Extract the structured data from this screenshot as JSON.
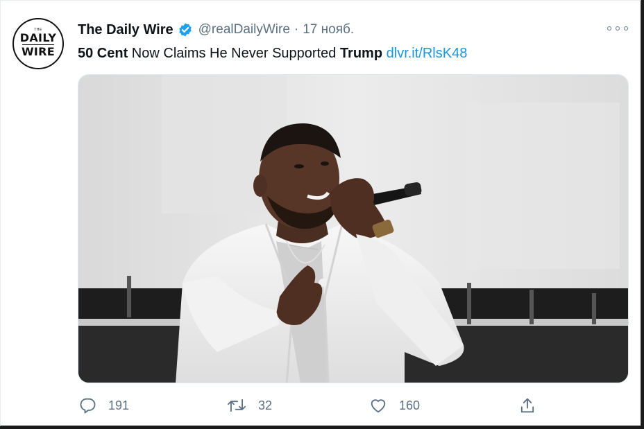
{
  "author": {
    "name": "The Daily Wire",
    "handle": "@realDailyWire",
    "separator": "·",
    "date": "17 нояб.",
    "avatar": {
      "top_text": "THE",
      "line1": "DAILY",
      "line2": "WIRE"
    }
  },
  "tweet": {
    "part1_bold": "50 Cent",
    "part2": " Now Claims He Never Supported ",
    "part3_bold": "Trump",
    "part4": " ",
    "link": "dlvr.it/RlsK48"
  },
  "media": {
    "description_icon": "photo-performer"
  },
  "actions": {
    "reply_count": "191",
    "retweet_count": "32",
    "like_count": "160"
  },
  "colors": {
    "link": "#1b95e0",
    "verified": "#1da1f2",
    "muted": "#5b7083"
  }
}
